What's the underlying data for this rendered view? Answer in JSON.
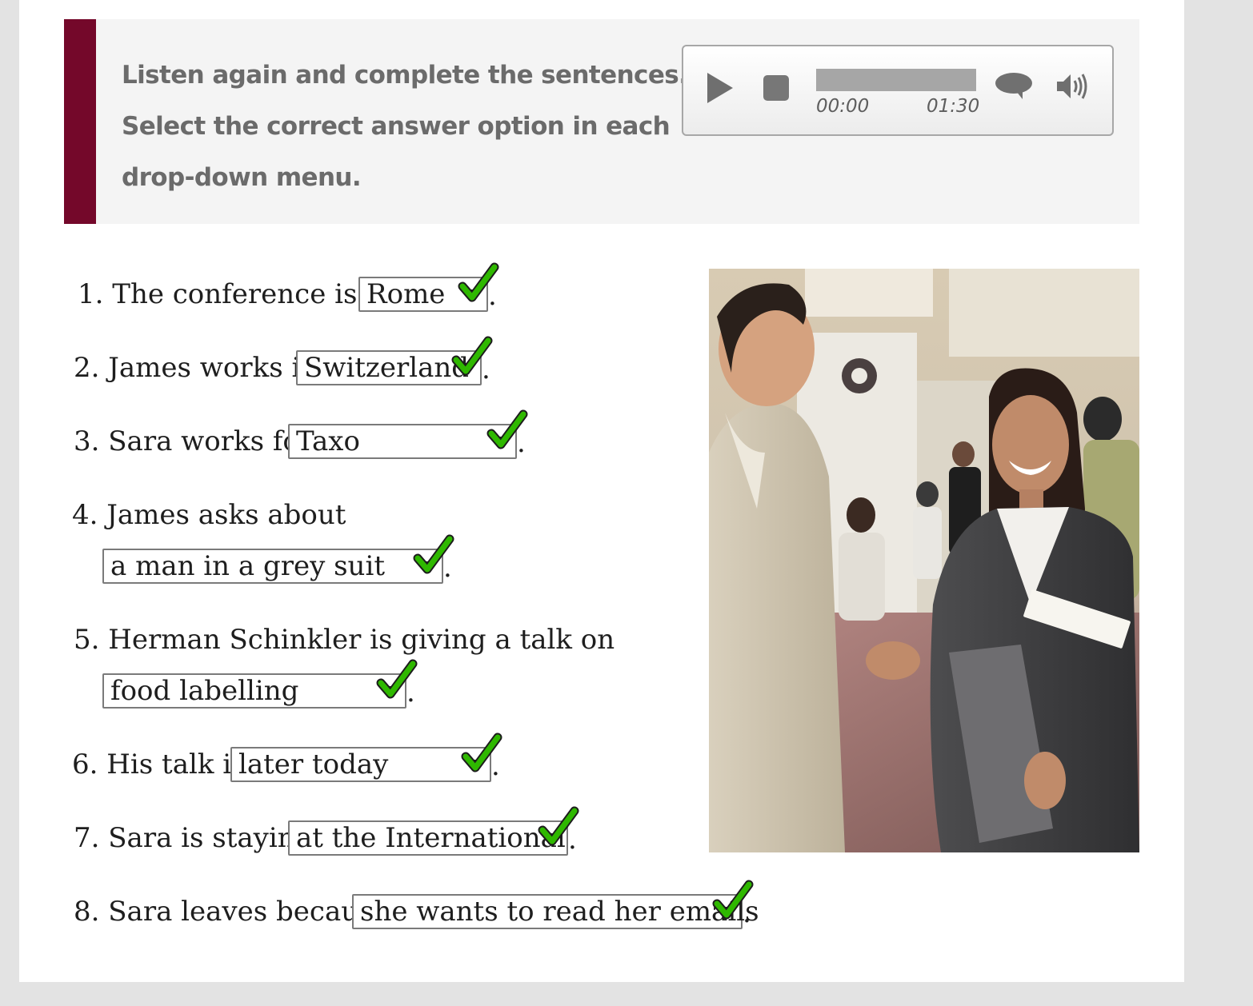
{
  "instructions": {
    "line1": "Listen again and complete the sentences.",
    "line2": "Select the correct answer option in each",
    "line3": "drop-down menu."
  },
  "player": {
    "current_time": "00:00",
    "total_time": "01:30",
    "progress": 0,
    "icons": [
      "play-icon",
      "stop-icon",
      "caption-icon",
      "volume-icon"
    ]
  },
  "questions": [
    {
      "number": "1.",
      "prompt": "The conference is in",
      "answer": "Rome",
      "end": "."
    },
    {
      "number": "2.",
      "prompt": "James works in",
      "answer": "Switzerland",
      "end": "."
    },
    {
      "number": "3.",
      "prompt": "Sara works for",
      "answer": "Taxo",
      "end": "."
    },
    {
      "number": "4.",
      "prompt": "James asks about",
      "answer": "a man in a grey suit",
      "end": "."
    },
    {
      "number": "5.",
      "prompt": "Herman Schinkler is giving a talk on",
      "answer": "food labelling",
      "end": "."
    },
    {
      "number": "6.",
      "prompt": "His talk is",
      "answer": "later today",
      "end": "."
    },
    {
      "number": "7.",
      "prompt": "Sara is staying",
      "answer": "at the International",
      "end": "."
    },
    {
      "number": "8.",
      "prompt": "Sara leaves because",
      "answer": "she wants to read her emails",
      "end": "."
    }
  ],
  "colors": {
    "accent_bar": "#74082a",
    "check_green": "#2fb800"
  }
}
